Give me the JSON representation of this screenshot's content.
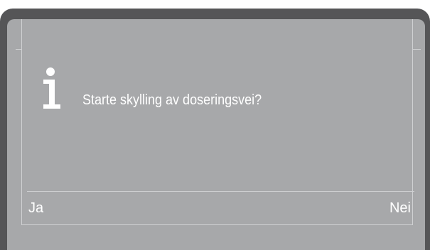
{
  "dialog": {
    "icon": "info-icon",
    "message": "Starte skylling av doseringsvei?"
  },
  "softkeys": {
    "left_label": "Ja",
    "right_label": "Nei"
  },
  "colors": {
    "bezel": "#555557",
    "screen": "#a7a8aa",
    "text": "#ffffff"
  }
}
